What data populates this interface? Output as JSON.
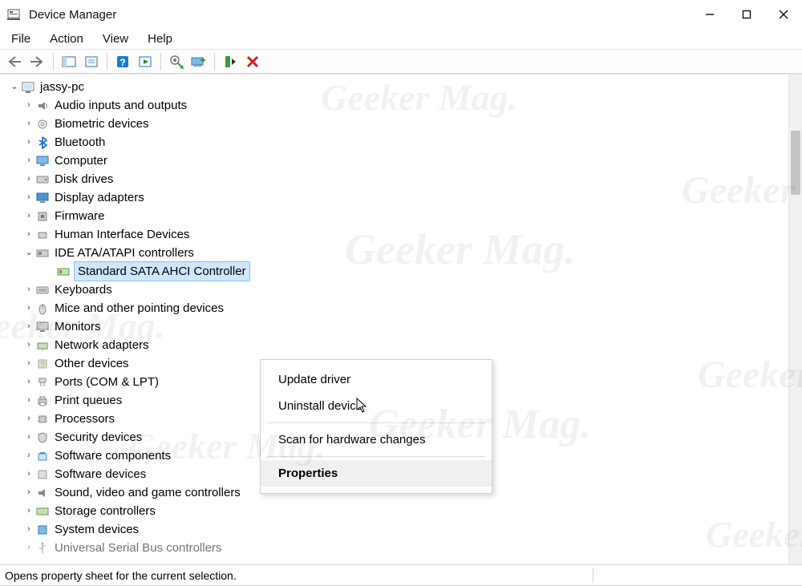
{
  "window": {
    "title": "Device Manager"
  },
  "menu": {
    "file": "File",
    "action": "Action",
    "view": "View",
    "help": "Help"
  },
  "tree": {
    "root": "jassy-pc",
    "items": [
      {
        "label": "Audio inputs and outputs"
      },
      {
        "label": "Biometric devices"
      },
      {
        "label": "Bluetooth"
      },
      {
        "label": "Computer"
      },
      {
        "label": "Disk drives"
      },
      {
        "label": "Display adapters"
      },
      {
        "label": "Firmware"
      },
      {
        "label": "Human Interface Devices"
      },
      {
        "label": "IDE ATA/ATAPI controllers",
        "expanded": true,
        "child": "Standard SATA AHCI Controller"
      },
      {
        "label": "Keyboards"
      },
      {
        "label": "Mice and other pointing devices"
      },
      {
        "label": "Monitors"
      },
      {
        "label": "Network adapters"
      },
      {
        "label": "Other devices"
      },
      {
        "label": "Ports (COM & LPT)"
      },
      {
        "label": "Print queues"
      },
      {
        "label": "Processors"
      },
      {
        "label": "Security devices"
      },
      {
        "label": "Software components"
      },
      {
        "label": "Software devices"
      },
      {
        "label": "Sound, video and game controllers"
      },
      {
        "label": "Storage controllers"
      },
      {
        "label": "System devices"
      },
      {
        "label": "Universal Serial Bus controllers"
      }
    ]
  },
  "context": {
    "update": "Update driver",
    "uninstall": "Uninstall device",
    "scan": "Scan for hardware changes",
    "properties": "Properties"
  },
  "status": "Opens property sheet for the current selection.",
  "watermark": "Geeker Mag."
}
